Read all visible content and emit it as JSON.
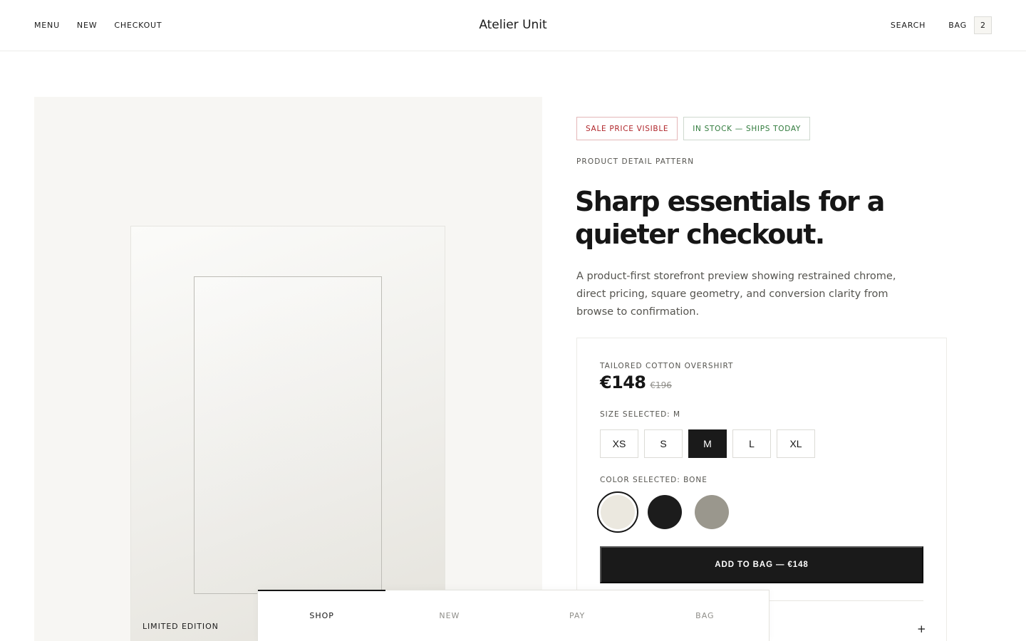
{
  "header": {
    "nav_left": [
      "MENU",
      "NEW",
      "CHECKOUT"
    ],
    "brand": "Atelier Unit",
    "search_label": "SEARCH",
    "bag_label": "BAG",
    "bag_count": "2"
  },
  "gallery": {
    "edition_label": "LIMITED EDITION"
  },
  "badges": {
    "sale": "SALE PRICE VISIBLE",
    "stock": "IN STOCK — SHIPS TODAY",
    "sale_color": "#b0262b",
    "stock_color": "#2f7a3b"
  },
  "intro": {
    "eyebrow": "PRODUCT DETAIL PATTERN",
    "headline": "Sharp essentials for a quieter checkout.",
    "lede": "A product-first storefront preview showing restrained chrome, direct pricing, square geometry, and conversion clarity from browse to confirmation."
  },
  "product": {
    "name": "TAILORED COTTON OVERSHIRT",
    "price": "€148",
    "old_price": "€196",
    "size_label": "SIZE SELECTED: M",
    "sizes": [
      "XS",
      "S",
      "M",
      "L",
      "XL"
    ],
    "selected_size": "M",
    "color_label": "COLOR SELECTED: BONE",
    "colors": [
      {
        "name": "bone",
        "hex": "#ebe8df",
        "selected": true
      },
      {
        "name": "black",
        "hex": "#1c1c1c",
        "selected": false
      },
      {
        "name": "stone",
        "hex": "#9a978d",
        "selected": false
      }
    ],
    "add_button": "ADD TO BAG — €148",
    "accordion_toggle": "+"
  },
  "tabbar": {
    "tabs": [
      "SHOP",
      "NEW",
      "PAY",
      "BAG"
    ],
    "active": "SHOP"
  }
}
